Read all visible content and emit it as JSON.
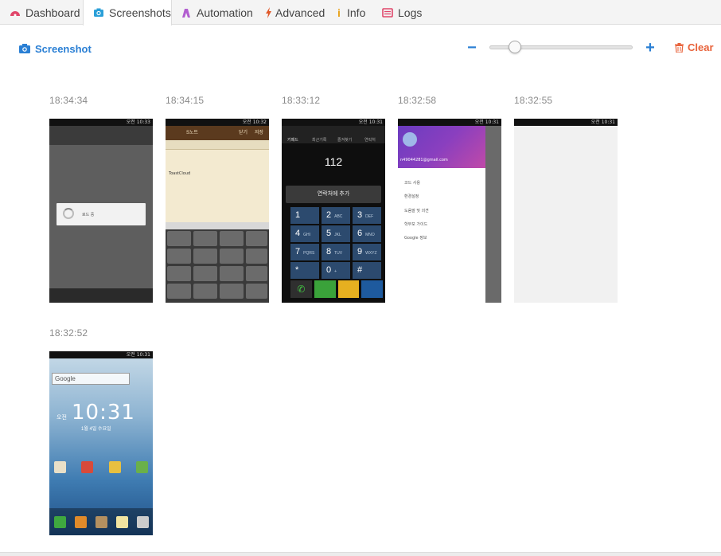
{
  "tabs": [
    {
      "label": "Dashboard",
      "icon": "dashboard-icon",
      "color": "#e0466a",
      "active": false
    },
    {
      "label": "Screenshots",
      "icon": "camera-icon",
      "color": "#2a9fd8",
      "active": true
    },
    {
      "label": "Automation",
      "icon": "automation-icon",
      "color": "#b25fd0",
      "active": false
    },
    {
      "label": "Advanced",
      "icon": "bolt-icon",
      "color": "#e05a2a",
      "active": false
    },
    {
      "label": "Info",
      "icon": "info-icon",
      "color": "#e8a21a",
      "active": false
    },
    {
      "label": "Logs",
      "icon": "logs-icon",
      "color": "#e0466a",
      "active": false
    }
  ],
  "toolbar": {
    "screenshot_label": "Screenshot",
    "zoom_minus": "−",
    "zoom_plus": "+",
    "zoom_level": 0.12,
    "clear_label": "Clear"
  },
  "colors": {
    "accent": "#2a7fd4",
    "danger": "#e8623a"
  },
  "screenshots": [
    {
      "time": "18:34:34",
      "status": "오전 10:33",
      "dialog_text": "로드 중"
    },
    {
      "time": "18:34:15",
      "status": "오전 10:32",
      "header_left": "S노트",
      "header_close": "닫기",
      "header_save": "저장",
      "note_text": "ToastCloud"
    },
    {
      "time": "18:33:12",
      "status": "오전 10:31",
      "tabs": [
        "키패드",
        "최근기록",
        "즐겨찾기",
        "연락처"
      ],
      "number": "112",
      "add_contact": "연락처에 추가",
      "keys": [
        [
          "1",
          ""
        ],
        [
          "2",
          "ABC"
        ],
        [
          "3",
          "DEF"
        ],
        [
          "4",
          "GHI"
        ],
        [
          "5",
          "JKL"
        ],
        [
          "6",
          "MNO"
        ],
        [
          "7",
          "PQRS"
        ],
        [
          "8",
          "TUV"
        ],
        [
          "9",
          "WXYZ"
        ],
        [
          "*",
          ""
        ],
        [
          "0",
          "+"
        ],
        [
          "#",
          ""
        ]
      ]
    },
    {
      "time": "18:32:58",
      "status": "오전 10:31",
      "account": "n49044281@gmail.com",
      "menu": [
        "코드 사용",
        "환경설정",
        "도움말 및 의견",
        "학부모 가이드",
        "Google 정보"
      ]
    },
    {
      "time": "18:32:55",
      "status": "오전 10:31"
    },
    {
      "time": "18:32:52",
      "status": "오전 10:31",
      "search": "Google",
      "ampm": "오전",
      "clock": "10:31",
      "date": "1월 4일 수요일"
    }
  ]
}
